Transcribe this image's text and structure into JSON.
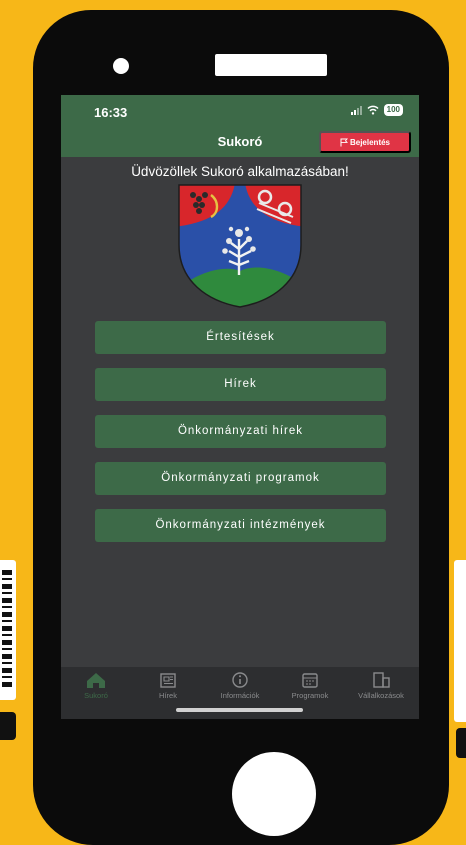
{
  "status_bar": {
    "time": "16:33",
    "battery": "100"
  },
  "header": {
    "title": "Sukoró",
    "report_button": "Bejelentés"
  },
  "welcome_text": "Üdvözöllek Sukoró alkalmazásában!",
  "menu": [
    {
      "label": "Értesítések"
    },
    {
      "label": "Hírek"
    },
    {
      "label": "Önkormányzati hírek"
    },
    {
      "label": "Önkormányzati programok"
    },
    {
      "label": "Önkormányzati intézmények"
    }
  ],
  "tabs": [
    {
      "label": "Sukoró",
      "icon": "home-icon",
      "active": true
    },
    {
      "label": "Hírek",
      "icon": "newspaper-icon",
      "active": false
    },
    {
      "label": "Információk",
      "icon": "info-icon",
      "active": false
    },
    {
      "label": "Programok",
      "icon": "calendar-icon",
      "active": false
    },
    {
      "label": "Vállalkozások",
      "icon": "building-icon",
      "active": false
    }
  ],
  "colors": {
    "background": "#f7b718",
    "primary_green": "#3d6a48",
    "report_red": "#e03445",
    "screen_bg": "#3b3c3e",
    "tabbar_bg": "#2d2e30"
  }
}
